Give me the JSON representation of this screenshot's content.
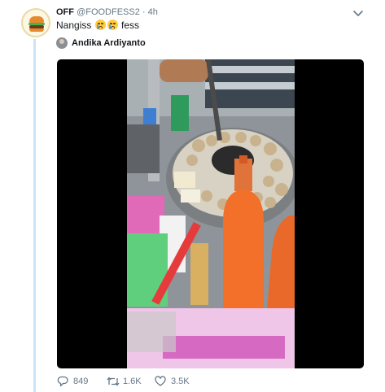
{
  "tweet": {
    "display_name": "OFF",
    "handle": "@FOODFESS2",
    "separator": "·",
    "time": "4h",
    "text_before": "Nangiss",
    "text_after": "fess",
    "emojis": [
      "loudly-crying-face-icon",
      "loudly-crying-face-icon"
    ],
    "tagged_user": "Andika Ardiyanto",
    "media": {
      "type": "video",
      "description_icon": "video-thumbnail"
    },
    "actions": {
      "reply_count": "849",
      "retweet_count": "1.6K",
      "like_count": "3.5K"
    }
  },
  "colors": {
    "thread_line": "#cce4f5",
    "meta_gray": "#657786",
    "text": "#14171a",
    "media_background": "#000000"
  }
}
